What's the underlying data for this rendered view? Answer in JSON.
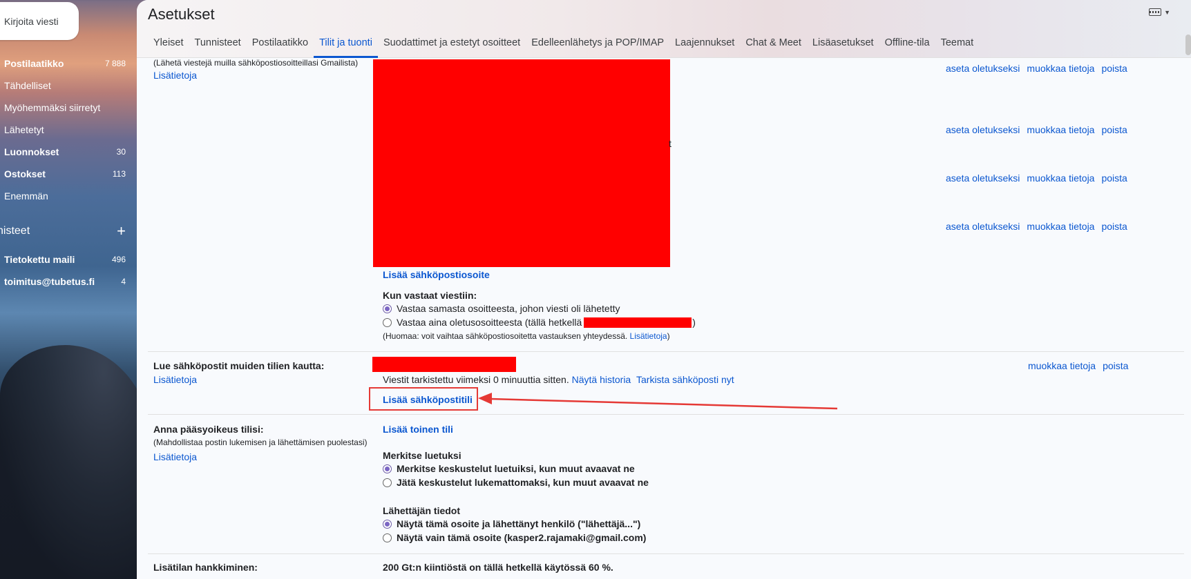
{
  "sidebar": {
    "compose_label": "Kirjoita viesti",
    "items": [
      {
        "label": "Postilaatikko",
        "count": "7 888",
        "bold": true
      },
      {
        "label": "Tähdelliset",
        "count": "",
        "bold": false
      },
      {
        "label": "Myöhemmäksi siirretyt",
        "count": "",
        "bold": false
      },
      {
        "label": "Lähetetyt",
        "count": "",
        "bold": false
      },
      {
        "label": "Luonnokset",
        "count": "30",
        "bold": true
      },
      {
        "label": "Ostokset",
        "count": "113",
        "bold": true
      },
      {
        "label": "Enemmän",
        "count": "",
        "bold": false
      }
    ],
    "labels_heading": "nisteet",
    "labels": [
      {
        "label": "Tietokettu maili",
        "count": "496"
      },
      {
        "label": "toimitus@tubetus.fi",
        "count": "4"
      }
    ]
  },
  "header": {
    "title": "Asetukset",
    "tabs": [
      "Yleiset",
      "Tunnisteet",
      "Postilaatikko",
      "Tilit ja tuonti",
      "Suodattimet ja estetyt osoitteet",
      "Edelleenlähetys ja POP/IMAP",
      "Laajennukset",
      "Chat & Meet",
      "Lisäasetukset",
      "Offline-tila",
      "Teemat"
    ],
    "active_tab": "Tilit ja tuonti"
  },
  "send_as": {
    "description": "(Lähetä viestejä muilla sähköpostiosoitteillasi Gmailista)",
    "learn_more": "Lisätietoja",
    "actions": {
      "set_default": "aseta oletukseksi",
      "edit": "muokkaa tietoja",
      "delete": "poista"
    },
    "partial_char": "t",
    "add_address": "Lisää sähköpostiosoite",
    "reply_heading": "Kun vastaat viestiin:",
    "reply_same": "Vastaa samasta osoitteesta, johon viesti oli lähetetty",
    "reply_default_prefix": "Vastaa aina oletusosoitteesta (tällä hetkellä",
    "reply_default_suffix": ")",
    "note_prefix": "(Huomaa: voit vaihtaa sähköpostiosoitetta vastauksen yhteydessä.",
    "note_link": "Lisätietoja",
    "note_suffix": ")"
  },
  "check_mail": {
    "label": "Lue sähköpostit muiden tilien kautta:",
    "learn_more": "Lisätietoja",
    "status": "Viestit tarkistettu viimeksi 0 minuuttia sitten.",
    "history": "Näytä historia",
    "check_now": "Tarkista sähköposti nyt",
    "edit": "muokkaa tietoja",
    "delete": "poista",
    "add_account": "Lisää sähköpostitili"
  },
  "grant_access": {
    "label": "Anna pääsyoikeus tilisi:",
    "description": "(Mahdollistaa postin lukemisen ja lähettämisen puolestasi)",
    "learn_more": "Lisätietoja",
    "add_account": "Lisää toinen tili",
    "mark_heading": "Merkitse luetuksi",
    "mark_read": "Merkitse keskustelut luetuiksi, kun muut avaavat ne",
    "mark_unread": "Jätä keskustelut lukemattomaksi, kun muut avaavat ne",
    "sender_heading": "Lähettäjän tiedot",
    "sender_both": "Näytä tämä osoite ja lähettänyt henkilö (\"lähettäjä...\")",
    "sender_only": "Näytä vain tämä osoite (kasper2.rajamaki@gmail.com)"
  },
  "storage": {
    "label": "Lisätilan hankkiminen:",
    "usage": "200 Gt:n kiintiöstä on tällä hetkellä käytössä 60 %."
  },
  "colors": {
    "accent": "#0b57d0",
    "redaction": "#ff0000",
    "annotation": "#e53935"
  }
}
